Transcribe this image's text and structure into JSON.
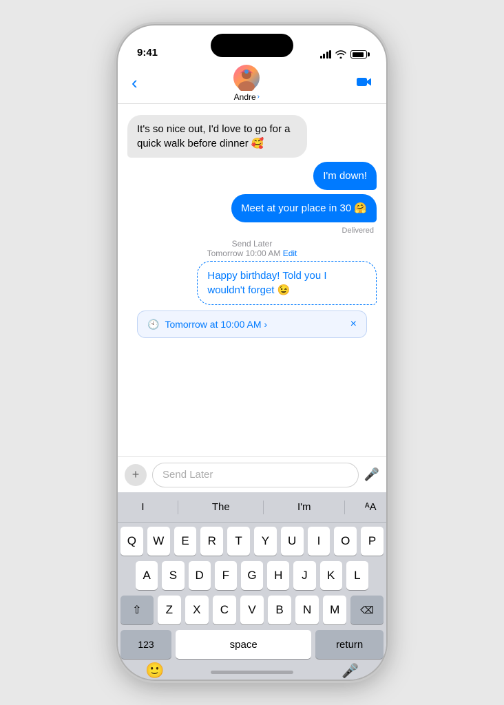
{
  "status": {
    "time": "9:41"
  },
  "nav": {
    "contact_name": "Andre",
    "chevron": "›",
    "back_symbol": "‹",
    "avatar_emoji": "👩‍🦱",
    "video_label": "video-call"
  },
  "messages": [
    {
      "id": "msg1",
      "type": "received",
      "text": "It's so nice out, I'd love to go for a quick walk before dinner 🥰"
    },
    {
      "id": "msg2",
      "type": "sent",
      "text": "I'm down!"
    },
    {
      "id": "msg3",
      "type": "sent",
      "text": "Meet at your place in 30 🤗"
    }
  ],
  "delivered_label": "Delivered",
  "send_later_label": "Send Later",
  "send_later_time": "Tomorrow 10:00 AM",
  "edit_label": "Edit",
  "scheduled_message": {
    "text": "Happy birthday! Told you I wouldn't forget 😉"
  },
  "scheduled_banner": {
    "time": "Tomorrow at 10:00 AM ›",
    "close": "×"
  },
  "input": {
    "placeholder": "Send Later"
  },
  "keyboard": {
    "predictive": [
      "I",
      "The",
      "I'm"
    ],
    "rows": [
      [
        "Q",
        "W",
        "E",
        "R",
        "T",
        "Y",
        "U",
        "I",
        "O",
        "P"
      ],
      [
        "A",
        "S",
        "D",
        "F",
        "G",
        "H",
        "J",
        "K",
        "L"
      ],
      [
        "Z",
        "X",
        "C",
        "V",
        "B",
        "N",
        "M"
      ],
      [
        "123",
        "space",
        "return"
      ]
    ],
    "space_label": "space",
    "return_label": "return",
    "num_label": "123"
  }
}
